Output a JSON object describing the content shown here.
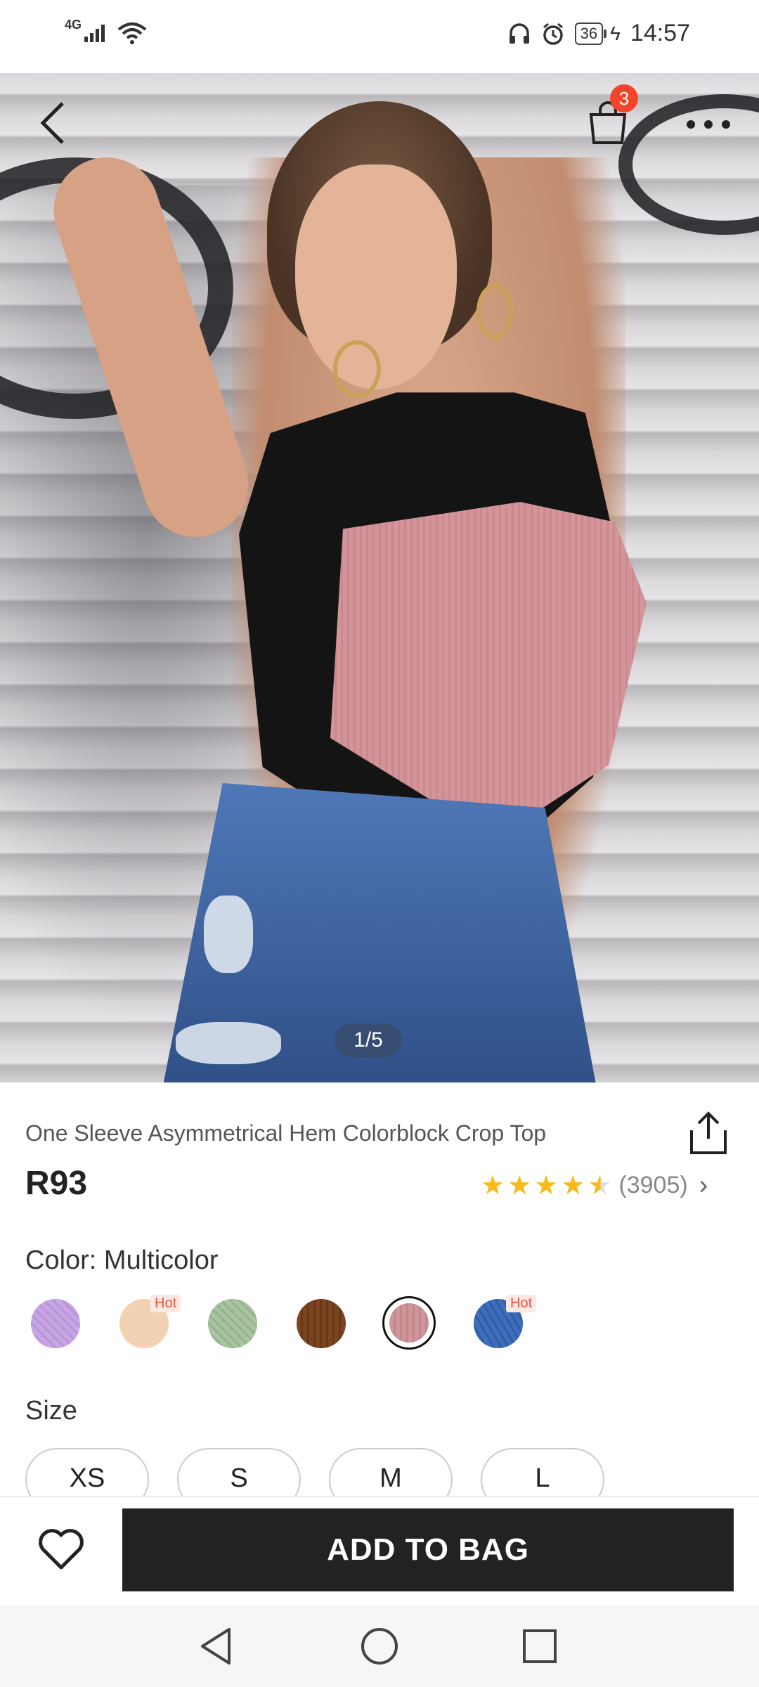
{
  "status_bar": {
    "network": "4G",
    "battery": "36",
    "time": "14:57",
    "icons": [
      "signal-icon",
      "wifi-icon",
      "headphones-icon",
      "alarm-icon",
      "battery-icon",
      "charging-icon"
    ]
  },
  "header": {
    "back_icon": "back-arrow-icon",
    "bag_icon": "shopping-bag-icon",
    "bag_count": "3",
    "more_icon": "more-dots-icon"
  },
  "gallery": {
    "indicator": "1/5"
  },
  "product": {
    "title": "One Sleeve Asymmetrical Hem Colorblock Crop Top",
    "price": "R93",
    "rating_stars": 4.5,
    "review_count": "(3905)",
    "share_icon": "share-icon"
  },
  "color": {
    "label": "Color: Multicolor",
    "swatches": [
      {
        "name": "lilac",
        "color": "#c7a6e3",
        "hot": ""
      },
      {
        "name": "apricot",
        "color": "#f3d2b4",
        "hot": "Hot"
      },
      {
        "name": "mint",
        "color": "#a9c4a0",
        "hot": ""
      },
      {
        "name": "brown",
        "color": "#7a4420",
        "hot": ""
      },
      {
        "name": "dusty-pink",
        "color": "#cf9699",
        "hot": "",
        "selected": true
      },
      {
        "name": "blue",
        "color": "#3f6fbb",
        "hot": "Hot"
      }
    ]
  },
  "size": {
    "label": "Size",
    "options": [
      "XS",
      "S",
      "M",
      "L"
    ]
  },
  "actions": {
    "wishlist_icon": "heart-icon",
    "add_to_bag": "ADD TO BAG"
  },
  "nav": {
    "back": "nav-back-icon",
    "home": "nav-home-icon",
    "recents": "nav-recents-icon"
  }
}
